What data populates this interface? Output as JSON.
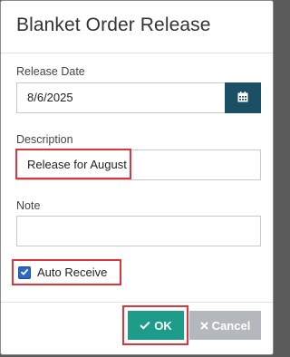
{
  "dialog": {
    "title": "Blanket Order Release",
    "release_date": {
      "label": "Release Date",
      "value": "8/6/2025"
    },
    "description": {
      "label": "Description",
      "value": "Release for August"
    },
    "note": {
      "label": "Note",
      "value": ""
    },
    "auto_receive": {
      "label": "Auto Receive",
      "checked": true
    },
    "buttons": {
      "ok": "OK",
      "cancel": "Cancel"
    }
  },
  "icons": {
    "calendar": "calendar-icon",
    "check": "check-icon",
    "close": "close-icon"
  },
  "colors": {
    "primary": "#1a4f66",
    "ok": "#1d9c8a",
    "cancel": "#b4b8bc",
    "highlight": "#d9363e",
    "checkbox": "#2c67c4"
  }
}
